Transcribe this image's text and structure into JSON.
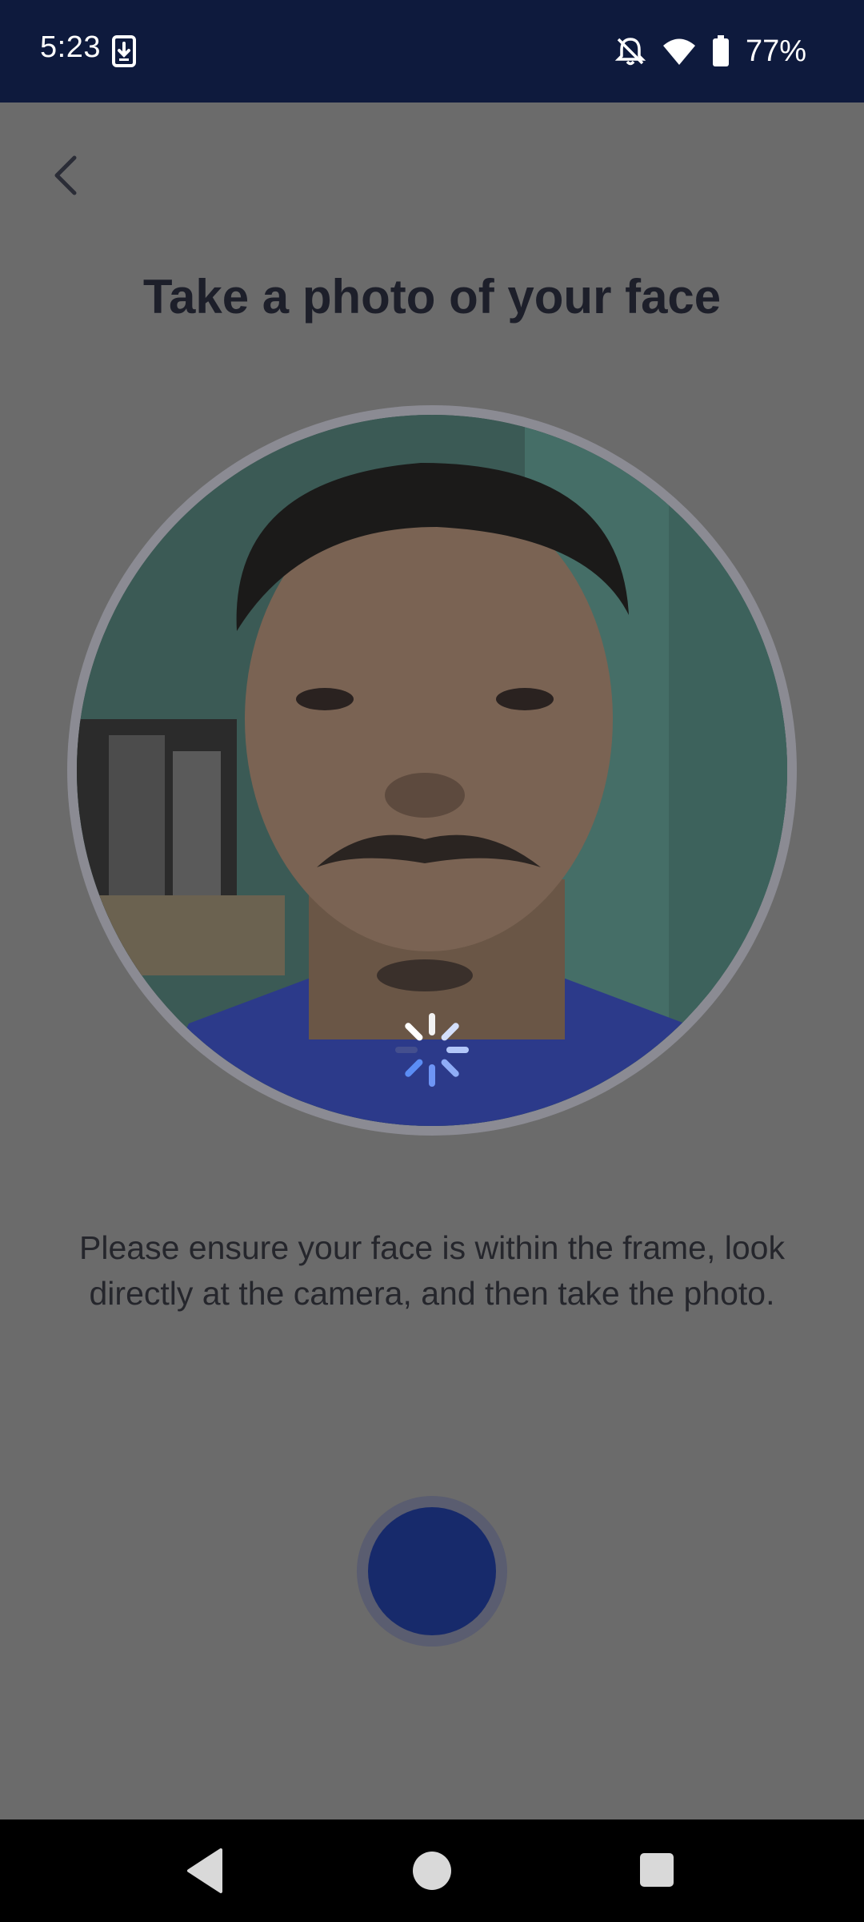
{
  "status_bar": {
    "time": "5:23",
    "battery_percent": "77%",
    "icons": [
      "download-icon",
      "notifications-off-icon",
      "wifi-icon",
      "battery-icon"
    ]
  },
  "header": {
    "back_icon": "chevron-left-icon",
    "title": "Take a photo of your face"
  },
  "camera": {
    "state": "loading",
    "spinner_icon": "loading-spinner-icon"
  },
  "instructions": "Please ensure your face is within the frame, look directly at the camera, and then take the photo.",
  "capture_button": {
    "icon": "shutter-button",
    "color": "#172a6b"
  },
  "nav_bar": {
    "icons": [
      "nav-back-icon",
      "nav-home-icon",
      "nav-recents-icon"
    ]
  },
  "colors": {
    "status_bar_bg": "#0e1a3d",
    "overlay_bg": "#6b6b6b",
    "spinner_accent": "#5b8df5"
  }
}
